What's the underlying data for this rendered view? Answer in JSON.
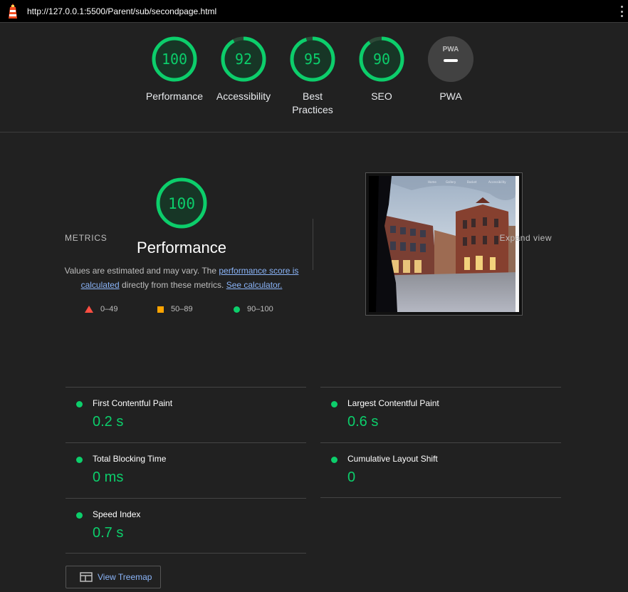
{
  "header": {
    "url": "http://127.0.0.1:5500/Parent/sub/secondpage.html"
  },
  "gauges": [
    {
      "score": "100",
      "label_line1": "Performance",
      "label_line2": ""
    },
    {
      "score": "92",
      "label_line1": "Accessibility",
      "label_line2": ""
    },
    {
      "score": "95",
      "label_line1": "Best",
      "label_line2": "Practices"
    },
    {
      "score": "90",
      "label_line1": "SEO",
      "label_line2": ""
    },
    {
      "score": "",
      "badge": "PWA",
      "label_line1": "PWA",
      "label_line2": ""
    }
  ],
  "performance": {
    "score": "100",
    "title": "Performance",
    "desc_part1": "Values are estimated and may vary. The ",
    "desc_link1": "performance score is calculated",
    "desc_part2": " directly from these metrics. ",
    "desc_link2": "See calculator.",
    "legend": [
      "0–49",
      "50–89",
      "90–100"
    ]
  },
  "metrics": {
    "title": "METRICS",
    "expand_label": "Expand view",
    "items": [
      {
        "name": "First Contentful Paint",
        "value": "0.2 s"
      },
      {
        "name": "Largest Contentful Paint",
        "value": "0.6 s"
      },
      {
        "name": "Total Blocking Time",
        "value": "0 ms"
      },
      {
        "name": "Cumulative Layout Shift",
        "value": "0"
      },
      {
        "name": "Speed Index",
        "value": "0.7 s"
      }
    ]
  },
  "treemap": {
    "label": "View Treemap"
  },
  "colors": {
    "pass": "#0cce6b",
    "average": "#ffa400",
    "fail": "#ff4e42",
    "link": "#8ab4f8"
  },
  "icons": {
    "logo": "lighthouse-icon",
    "menu": "kebab-menu-icon",
    "treemap": "treemap-icon"
  }
}
